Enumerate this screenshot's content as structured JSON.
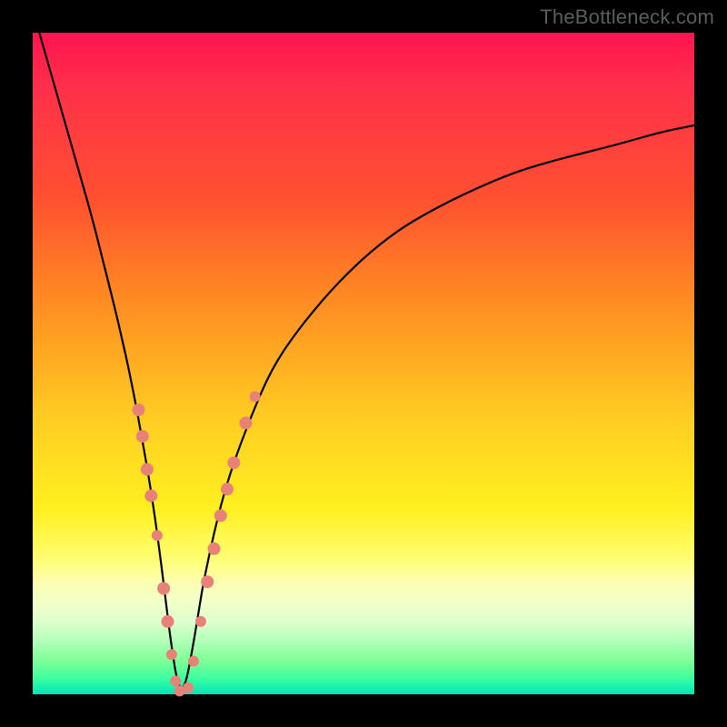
{
  "watermark": "TheBottleneck.com",
  "colors": {
    "frame": "#000000",
    "bead": "#e88278",
    "curve": "#000000"
  },
  "chart_data": {
    "type": "line",
    "title": "",
    "xlabel": "",
    "ylabel": "",
    "xlim": [
      0,
      100
    ],
    "ylim": [
      0,
      100
    ],
    "grid": false,
    "legend": false,
    "note": "V-shaped curve; y≈100 near x=0, drops to ≈0 at x≈22, rises back toward ≈86 at x=100",
    "series": [
      {
        "name": "curve",
        "x": [
          1,
          3,
          5,
          7,
          9,
          11,
          13,
          15,
          17,
          18,
          19,
          20,
          21,
          22,
          23,
          24,
          25,
          26,
          28,
          30,
          33,
          36,
          40,
          45,
          50,
          55,
          60,
          66,
          73,
          80,
          88,
          95,
          100
        ],
        "y": [
          100,
          93,
          86,
          79,
          72,
          64,
          56,
          47,
          36,
          30,
          23,
          15,
          7,
          1,
          1,
          6,
          12,
          18,
          27,
          34,
          42,
          49,
          55,
          61,
          66,
          70,
          73,
          76,
          79,
          81,
          83,
          85,
          86
        ]
      }
    ],
    "beads_left": [
      {
        "x": 16.0,
        "y": 43,
        "r": 7
      },
      {
        "x": 16.6,
        "y": 39,
        "r": 7
      },
      {
        "x": 17.3,
        "y": 34,
        "r": 7
      },
      {
        "x": 17.9,
        "y": 30,
        "r": 7
      },
      {
        "x": 18.8,
        "y": 24,
        "r": 6
      },
      {
        "x": 19.8,
        "y": 16,
        "r": 7
      },
      {
        "x": 20.4,
        "y": 11,
        "r": 7
      },
      {
        "x": 21.0,
        "y": 6,
        "r": 6
      },
      {
        "x": 21.6,
        "y": 2,
        "r": 6
      },
      {
        "x": 22.2,
        "y": 0.5,
        "r": 6
      }
    ],
    "beads_right": [
      {
        "x": 23.5,
        "y": 1,
        "r": 6
      },
      {
        "x": 24.3,
        "y": 5,
        "r": 6
      },
      {
        "x": 25.4,
        "y": 11,
        "r": 6
      },
      {
        "x": 26.4,
        "y": 17,
        "r": 7
      },
      {
        "x": 27.4,
        "y": 22,
        "r": 7
      },
      {
        "x": 28.4,
        "y": 27,
        "r": 7
      },
      {
        "x": 29.4,
        "y": 31,
        "r": 7
      },
      {
        "x": 30.4,
        "y": 35,
        "r": 7
      },
      {
        "x": 32.2,
        "y": 41,
        "r": 7
      },
      {
        "x": 33.6,
        "y": 45,
        "r": 6
      }
    ]
  }
}
